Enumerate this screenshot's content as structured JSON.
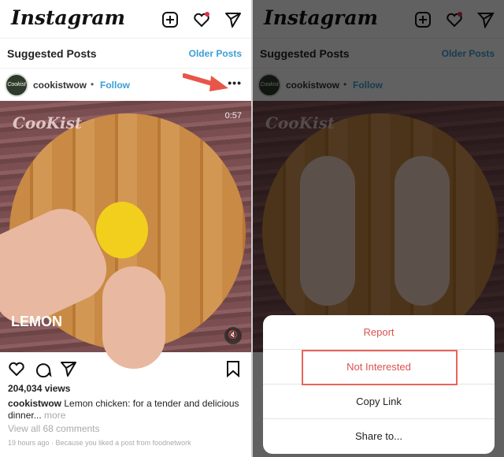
{
  "header": {
    "logo": "Instagram",
    "icons": [
      "new-post-icon",
      "heart-icon",
      "direct-icon"
    ]
  },
  "suggested": {
    "title": "Suggested Posts",
    "older": "Older Posts"
  },
  "post": {
    "username": "cookistwow",
    "separator": "•",
    "follow": "Follow",
    "avatar_text": "Cookist",
    "watermark": "CooKist",
    "duration": "0:57",
    "overlay_label": "LEMON",
    "views": "204,034 views",
    "caption": "Lemon chicken: for a tender and delicious dinner...",
    "more": "more",
    "comments": "View all 68 comments",
    "meta": "19 hours ago · Because you liked a post from foodnetwork"
  },
  "sheet": {
    "items": [
      "Report",
      "Not Interested",
      "Copy Link",
      "Share to..."
    ],
    "highlighted": "Not Interested"
  },
  "colors": {
    "link": "#3a9fd6",
    "danger": "#d9534f",
    "annotation": "#e8655a"
  }
}
